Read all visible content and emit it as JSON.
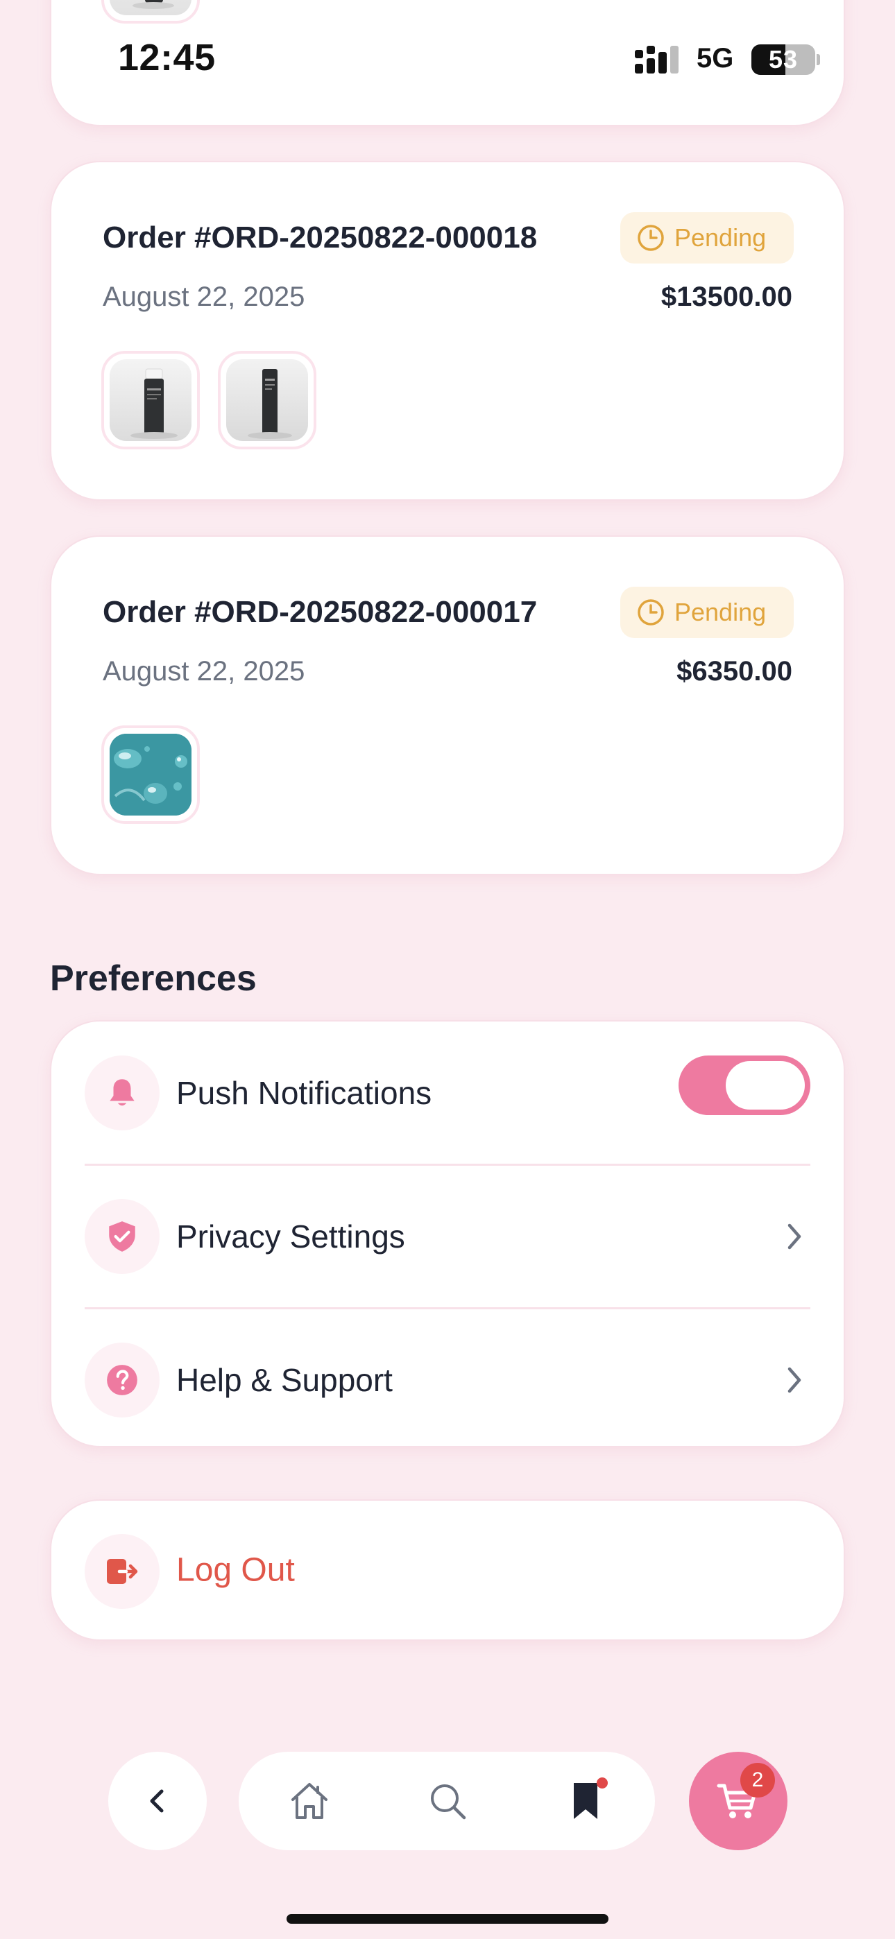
{
  "status_bar": {
    "time": "12:45",
    "network": "5G",
    "battery": "53",
    "battery_level": 0.53
  },
  "orders": [
    {
      "title": "Order #ORD-20250822-000018",
      "status": "Pending",
      "date": "August 22, 2025",
      "total": "$13500.00",
      "thumbnails": [
        "product-bottle",
        "product-bottle"
      ]
    },
    {
      "title": "Order #ORD-20250822-000017",
      "status": "Pending",
      "date": "August 22, 2025",
      "total": "$6350.00",
      "thumbnails": [
        "product-water-drops"
      ]
    }
  ],
  "preferences": {
    "title": "Preferences",
    "items": [
      {
        "label": "Push Notifications",
        "icon": "bell-icon",
        "control": "toggle",
        "on": true
      },
      {
        "label": "Privacy Settings",
        "icon": "shield-check-icon",
        "control": "chevron"
      },
      {
        "label": "Help & Support",
        "icon": "question-circle-icon",
        "control": "chevron"
      }
    ]
  },
  "logout": {
    "label": "Log Out",
    "icon": "logout-icon"
  },
  "bottom_nav": {
    "items": [
      "back-icon",
      "home-icon",
      "search-icon",
      "bookmark-icon",
      "cart-icon"
    ],
    "cart_count": "2"
  },
  "colors": {
    "background": "#fbebf0",
    "accent": "#ee7aa0",
    "pending_text": "#e0a43c",
    "pending_bg": "#fdf3e2",
    "danger": "#e0574a"
  }
}
